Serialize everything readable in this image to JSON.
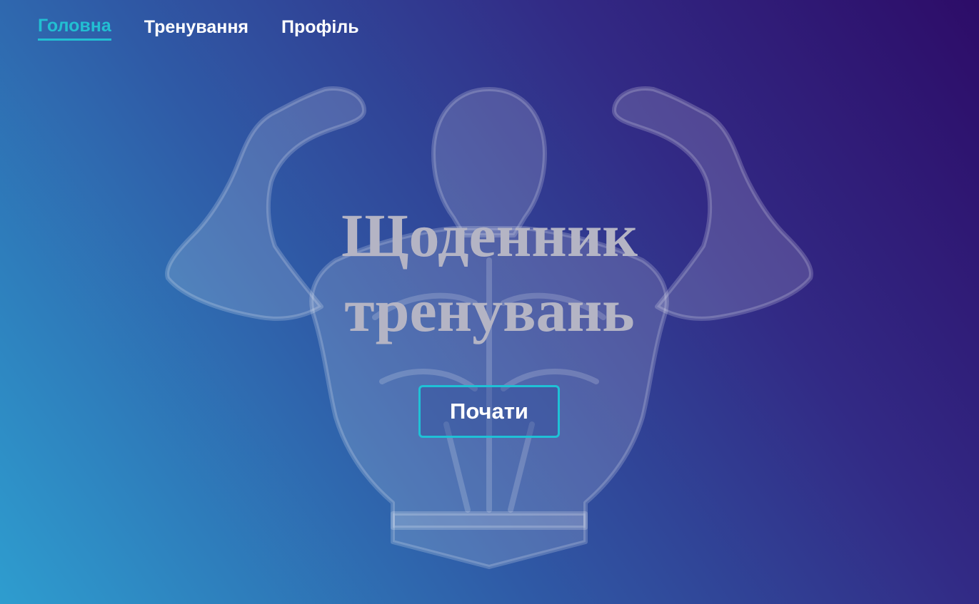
{
  "nav": {
    "items": [
      {
        "label": "Головна",
        "active": true
      },
      {
        "label": "Тренування",
        "active": false
      },
      {
        "label": "Профіль",
        "active": false
      }
    ]
  },
  "hero": {
    "title_line1": "Щоденник",
    "title_line2": "тренувань",
    "button_label": "Почати",
    "background_image": "bodybuilder-silhouette-icon"
  },
  "colors": {
    "accent": "#22bfd2",
    "gradient_start": "#2d0c68",
    "gradient_end": "#2e9dcf",
    "title": "#b4b4c4"
  }
}
